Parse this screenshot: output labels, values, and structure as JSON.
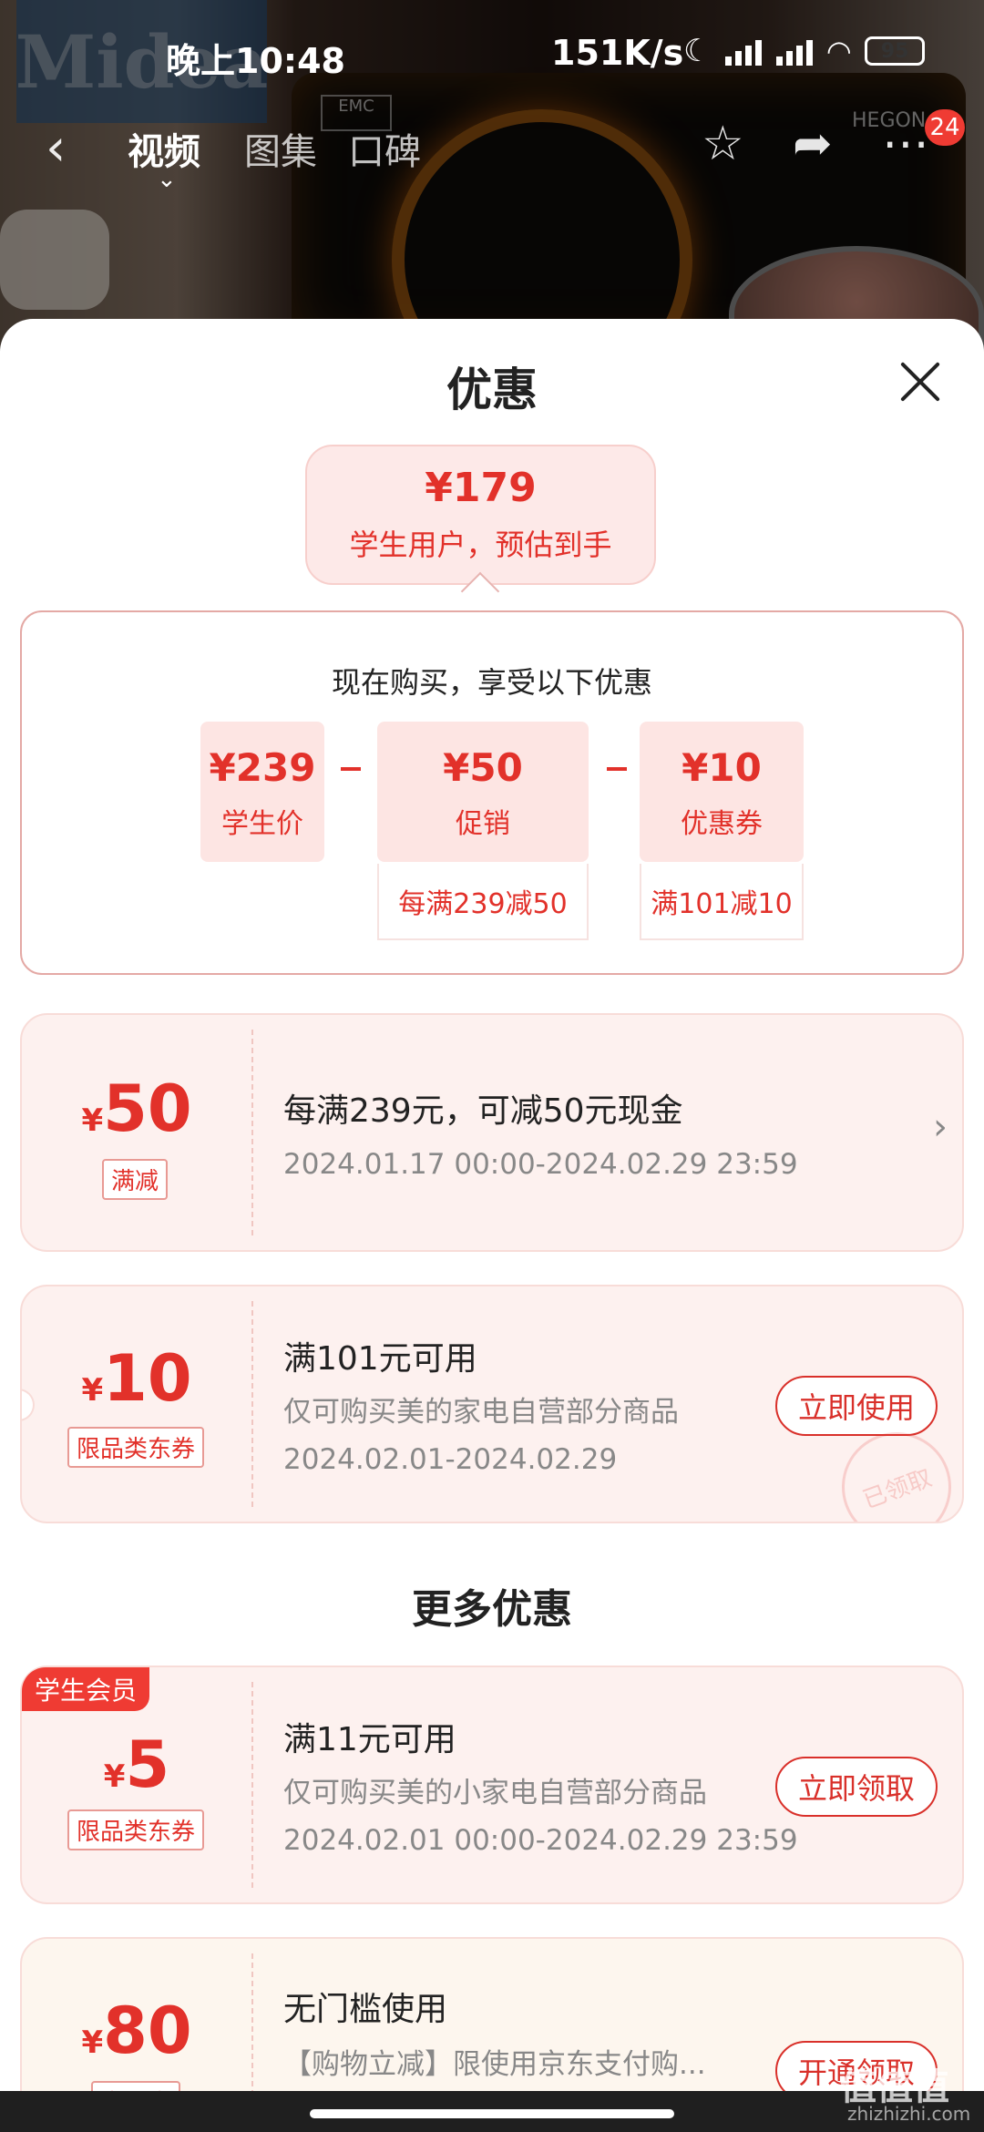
{
  "status_bar": {
    "time": "晚上10:48",
    "net_speed": "151K/s",
    "battery": "95"
  },
  "background": {
    "brand_logo": "Midea",
    "emc_label": "EMC",
    "hegon_label": "HEGON"
  },
  "top_nav": {
    "tabs": [
      "视频",
      "图集",
      "口碑"
    ],
    "badge_count": "24"
  },
  "sheet": {
    "title": "优惠",
    "estimate": {
      "price": "¥179",
      "label": "学生用户，预估到手"
    },
    "breakdown": {
      "title": "现在购买，享受以下优惠",
      "items": [
        {
          "value": "¥239",
          "label": "学生价",
          "rule": ""
        },
        {
          "value": "¥50",
          "label": "促销",
          "rule": "每满239减50"
        },
        {
          "value": "¥10",
          "label": "优惠券",
          "rule": "满101减10"
        }
      ]
    },
    "coupons": [
      {
        "yen": "¥",
        "amount": "50",
        "tag": "满减",
        "title": "每满239元，可减50元现金",
        "lines": [
          "2024.01.17 00:00-2024.02.29 23:59"
        ]
      },
      {
        "yen": "¥",
        "amount": "10",
        "tag": "限品类东券",
        "title": "满101元可用",
        "lines": [
          "仅可购买美的家电自营部分商品",
          "2024.02.01-2024.02.29"
        ],
        "action": "立即使用",
        "stamp": "已领取"
      }
    ],
    "more_title": "更多优惠",
    "more_coupons": [
      {
        "member_tag": "学生会员",
        "yen": "¥",
        "amount": "5",
        "tag": "限品类东券",
        "title": "满11元可用",
        "lines": [
          "仅可购买美的小家电自营部分商品",
          "2024.02.01 00:00-2024.02.29 23:59"
        ],
        "action": "立即领取"
      },
      {
        "yen": "¥",
        "amount": "80",
        "tag": "支付券",
        "title": "无门槛使用",
        "lines": [
          "【购物立减】限使用京东支付购..."
        ],
        "action": "开通领取"
      }
    ]
  },
  "watermark": {
    "main": "值值值",
    "sub": "zhizhizhi.com"
  },
  "colors": {
    "accent": "#e2312a",
    "card_bg": "#fdf1ef",
    "badge": "#ef3b33"
  }
}
